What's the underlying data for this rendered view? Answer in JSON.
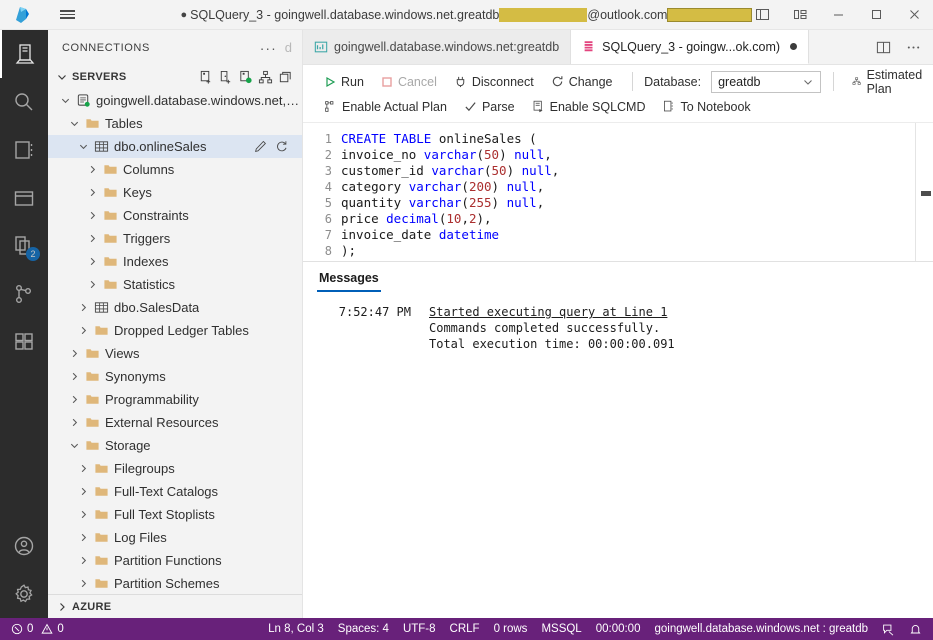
{
  "titlebar": {
    "dirty_indicator": "●",
    "title_prefix": "SQLQuery_3 - goingwell.database.windows.net.greatdb",
    "title_middle": "@outlook.com",
    "redacted_1": "",
    "redacted_2": "",
    "hamburger_icon": "hamburger-menu-icon",
    "logo_icon": "azure-data-studio-logo",
    "controls": [
      {
        "name": "toggle-panel-button",
        "icon": "panel-layout-icon"
      },
      {
        "name": "toggle-sidebar-button",
        "icon": "sidebar-layout-icon"
      },
      {
        "name": "customize-layout-button",
        "icon": "customize-layout-icon"
      },
      {
        "name": "minimize-button",
        "icon": "minimize-icon"
      },
      {
        "name": "maximize-button",
        "icon": "maximize-icon"
      },
      {
        "name": "close-button",
        "icon": "close-icon"
      }
    ]
  },
  "activitybar": {
    "items": [
      {
        "name": "servers",
        "icon": "servers-icon",
        "active": true,
        "badge": ""
      },
      {
        "name": "search",
        "icon": "search-icon",
        "active": false,
        "badge": ""
      },
      {
        "name": "notebooks",
        "icon": "notebook-icon",
        "active": false,
        "badge": ""
      },
      {
        "name": "dashboard",
        "icon": "dashboard-icon",
        "active": false,
        "badge": ""
      },
      {
        "name": "explorer",
        "icon": "files-icon",
        "active": false,
        "badge": "2"
      },
      {
        "name": "source-control",
        "icon": "source-control-icon",
        "active": false,
        "badge": ""
      },
      {
        "name": "extensions",
        "icon": "extensions-icon",
        "active": false,
        "badge": ""
      }
    ],
    "bottom": [
      {
        "name": "accounts",
        "icon": "account-icon"
      },
      {
        "name": "manage-settings",
        "icon": "gear-icon"
      }
    ]
  },
  "sidebar": {
    "header": {
      "title": "CONNECTIONS",
      "more_actions": "···",
      "ghost_char": "d"
    },
    "section": {
      "label": "SERVERS",
      "actions": [
        {
          "name": "new-connection-button",
          "icon": "new-connection-icon"
        },
        {
          "name": "new-server-group-button",
          "icon": "new-server-group-icon"
        },
        {
          "name": "connect-button",
          "icon": "connect-icon"
        },
        {
          "name": "server-groups-button",
          "icon": "server-groups-icon"
        },
        {
          "name": "collapse-all-button",
          "icon": "collapse-all-icon"
        }
      ]
    },
    "tree": [
      {
        "label": "goingwell.database.windows.net, g...",
        "indent": 1,
        "twisty": "down",
        "icon": "server-icon",
        "selected": false
      },
      {
        "label": "Tables",
        "indent": 2,
        "twisty": "down",
        "icon": "folder-icon",
        "selected": false
      },
      {
        "label": "dbo.onlineSales",
        "indent": 3,
        "twisty": "down",
        "icon": "table-icon",
        "selected": true,
        "actions": [
          "edit-icon",
          "refresh-icon"
        ]
      },
      {
        "label": "Columns",
        "indent": 4,
        "twisty": "right",
        "icon": "folder-icon",
        "selected": false
      },
      {
        "label": "Keys",
        "indent": 4,
        "twisty": "right",
        "icon": "folder-icon",
        "selected": false
      },
      {
        "label": "Constraints",
        "indent": 4,
        "twisty": "right",
        "icon": "folder-icon",
        "selected": false
      },
      {
        "label": "Triggers",
        "indent": 4,
        "twisty": "right",
        "icon": "folder-icon",
        "selected": false
      },
      {
        "label": "Indexes",
        "indent": 4,
        "twisty": "right",
        "icon": "folder-icon",
        "selected": false
      },
      {
        "label": "Statistics",
        "indent": 4,
        "twisty": "right",
        "icon": "folder-icon",
        "selected": false
      },
      {
        "label": "dbo.SalesData",
        "indent": 3,
        "twisty": "right",
        "icon": "table-icon",
        "selected": false
      },
      {
        "label": "Dropped Ledger Tables",
        "indent": 3,
        "twisty": "right",
        "icon": "folder-icon",
        "selected": false
      },
      {
        "label": "Views",
        "indent": 2,
        "twisty": "right",
        "icon": "folder-icon",
        "selected": false
      },
      {
        "label": "Synonyms",
        "indent": 2,
        "twisty": "right",
        "icon": "folder-icon",
        "selected": false
      },
      {
        "label": "Programmability",
        "indent": 2,
        "twisty": "right",
        "icon": "folder-icon",
        "selected": false
      },
      {
        "label": "External Resources",
        "indent": 2,
        "twisty": "right",
        "icon": "folder-icon",
        "selected": false
      },
      {
        "label": "Storage",
        "indent": 2,
        "twisty": "down",
        "icon": "folder-icon",
        "selected": false
      },
      {
        "label": "Filegroups",
        "indent": 3,
        "twisty": "right",
        "icon": "folder-icon",
        "selected": false
      },
      {
        "label": "Full-Text Catalogs",
        "indent": 3,
        "twisty": "right",
        "icon": "folder-icon",
        "selected": false
      },
      {
        "label": "Full Text Stoplists",
        "indent": 3,
        "twisty": "right",
        "icon": "folder-icon",
        "selected": false
      },
      {
        "label": "Log Files",
        "indent": 3,
        "twisty": "right",
        "icon": "folder-icon",
        "selected": false
      },
      {
        "label": "Partition Functions",
        "indent": 3,
        "twisty": "right",
        "icon": "folder-icon",
        "selected": false
      },
      {
        "label": "Partition Schemes",
        "indent": 3,
        "twisty": "right",
        "icon": "folder-icon",
        "selected": false
      }
    ],
    "footer": {
      "label": "AZURE",
      "twisty": "right"
    }
  },
  "tabs": [
    {
      "label": "goingwell.database.windows.net:greatdb",
      "icon": "dashboard-tab-icon",
      "active": false,
      "dirty": false
    },
    {
      "label": "SQLQuery_3 - goingw...ok.com)",
      "icon": "query-file-icon",
      "active": true,
      "dirty": true
    }
  ],
  "tabbar_actions": [
    {
      "name": "split-editor-button",
      "icon": "split-editor-icon"
    },
    {
      "name": "editor-actions-button",
      "icon": "more-actions-icon"
    }
  ],
  "query_toolbar": {
    "row1": [
      {
        "name": "run-button",
        "label": "Run",
        "icon": "play-icon",
        "disabled": false
      },
      {
        "name": "cancel-button",
        "label": "Cancel",
        "icon": "stop-icon",
        "disabled": true
      },
      {
        "name": "disconnect-button",
        "label": "Disconnect",
        "icon": "disconnect-icon",
        "disabled": false
      },
      {
        "name": "change-connection-button",
        "label": "Change",
        "icon": "change-connection-icon",
        "disabled": false
      }
    ],
    "database_label": "Database:",
    "database_value": "greatdb",
    "estimated_plan": {
      "name": "estimated-plan-button",
      "label": "Estimated Plan",
      "icon": "plan-icon"
    },
    "row2": [
      {
        "name": "enable-actual-plan-button",
        "label": "Enable Actual Plan",
        "icon": "actual-plan-icon"
      },
      {
        "name": "parse-button",
        "label": "Parse",
        "icon": "check-icon"
      },
      {
        "name": "enable-sqlcmd-button",
        "label": "Enable SQLCMD",
        "icon": "sqlcmd-icon"
      },
      {
        "name": "to-notebook-button",
        "label": "To Notebook",
        "icon": "notebook-convert-icon"
      }
    ]
  },
  "editor": {
    "lines": [
      {
        "n": "1",
        "tokens": [
          {
            "t": "CREATE TABLE ",
            "c": "k-kw"
          },
          {
            "t": "onlineSales (",
            "c": ""
          }
        ]
      },
      {
        "n": "2",
        "tokens": [
          {
            "t": "invoice_no ",
            "c": ""
          },
          {
            "t": "varchar",
            "c": "k-type"
          },
          {
            "t": "(",
            "c": ""
          },
          {
            "t": "50",
            "c": "k-num"
          },
          {
            "t": ") ",
            "c": ""
          },
          {
            "t": "null",
            "c": "k-kw"
          },
          {
            "t": ",",
            "c": ""
          }
        ]
      },
      {
        "n": "3",
        "tokens": [
          {
            "t": "customer_id ",
            "c": ""
          },
          {
            "t": "varchar",
            "c": "k-type"
          },
          {
            "t": "(",
            "c": ""
          },
          {
            "t": "50",
            "c": "k-num"
          },
          {
            "t": ") ",
            "c": ""
          },
          {
            "t": "null",
            "c": "k-kw"
          },
          {
            "t": ",",
            "c": ""
          }
        ]
      },
      {
        "n": "4",
        "tokens": [
          {
            "t": "category ",
            "c": ""
          },
          {
            "t": "varchar",
            "c": "k-type"
          },
          {
            "t": "(",
            "c": ""
          },
          {
            "t": "200",
            "c": "k-num"
          },
          {
            "t": ") ",
            "c": ""
          },
          {
            "t": "null",
            "c": "k-kw"
          },
          {
            "t": ",",
            "c": ""
          }
        ]
      },
      {
        "n": "5",
        "tokens": [
          {
            "t": "quantity ",
            "c": ""
          },
          {
            "t": "varchar",
            "c": "k-type"
          },
          {
            "t": "(",
            "c": ""
          },
          {
            "t": "255",
            "c": "k-num"
          },
          {
            "t": ") ",
            "c": ""
          },
          {
            "t": "null",
            "c": "k-kw"
          },
          {
            "t": ",",
            "c": ""
          }
        ]
      },
      {
        "n": "6",
        "tokens": [
          {
            "t": "price ",
            "c": ""
          },
          {
            "t": "decimal",
            "c": "k-type"
          },
          {
            "t": "(",
            "c": ""
          },
          {
            "t": "10",
            "c": "k-num"
          },
          {
            "t": ",",
            "c": ""
          },
          {
            "t": "2",
            "c": "k-num"
          },
          {
            "t": "),",
            "c": ""
          }
        ]
      },
      {
        "n": "7",
        "tokens": [
          {
            "t": "invoice_date ",
            "c": ""
          },
          {
            "t": "datetime",
            "c": "k-type"
          }
        ]
      },
      {
        "n": "8",
        "tokens": [
          {
            "t": ");",
            "c": ""
          }
        ]
      }
    ]
  },
  "panel": {
    "tab_label": "Messages",
    "messages": [
      {
        "time": "7:52:47 PM",
        "text": "Started executing query at Line 1",
        "link": true
      },
      {
        "time": "",
        "text": "Commands completed successfully.",
        "link": false
      },
      {
        "time": "",
        "text": "Total execution time: 00:00:00.091",
        "link": false
      }
    ]
  },
  "statusbar": {
    "errors": "0",
    "warnings": "0",
    "items": [
      {
        "name": "status-line-col",
        "label": "Ln 8, Col 3"
      },
      {
        "name": "status-spaces",
        "label": "Spaces: 4"
      },
      {
        "name": "status-encoding",
        "label": "UTF-8"
      },
      {
        "name": "status-eol",
        "label": "CRLF"
      },
      {
        "name": "status-rows",
        "label": "0 rows"
      },
      {
        "name": "status-language",
        "label": "MSSQL"
      },
      {
        "name": "status-exec-time",
        "label": "00:00:00"
      },
      {
        "name": "status-connection",
        "label": "goingwell.database.windows.net : greatdb"
      }
    ],
    "right_icons": [
      {
        "name": "feedback-icon"
      },
      {
        "name": "notifications-bell-icon"
      }
    ]
  }
}
